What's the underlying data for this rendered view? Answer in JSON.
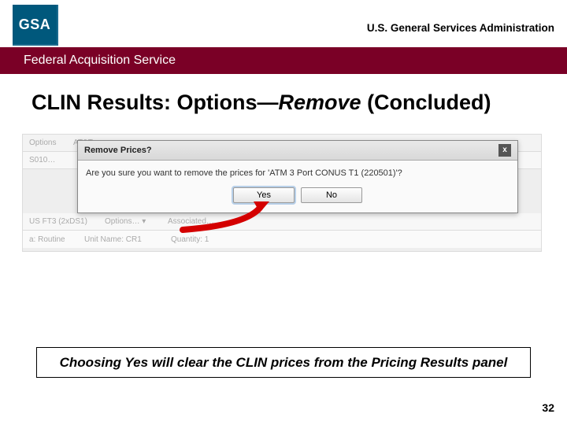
{
  "header": {
    "logo_text": "GSA",
    "agency": "U.S. General Services Administration",
    "band": "Federal Acquisition Service"
  },
  "title": {
    "part1": "CLIN Results:  Options—",
    "italic": "Remove",
    "part2": " (Concluded)"
  },
  "bg": {
    "r1a": "Options",
    "r1b": "AT&T",
    "r2a": "S010…",
    "r3a": "US FT3 (2xDS1)",
    "r3b": "Options… ▾",
    "r3c": "Associated…",
    "r4a": "a: Routine",
    "r4b": "Unit Name:  CR1",
    "r4c": "Quantity: 1"
  },
  "modal": {
    "title": "Remove Prices?",
    "close": "x",
    "body": "Are you sure you want to remove the prices for 'ATM 3 Port CONUS T1 (220501)'?",
    "yes": "Yes",
    "no": "No"
  },
  "caption": "Choosing Yes will clear the CLIN prices from the Pricing Results panel",
  "page": "32"
}
